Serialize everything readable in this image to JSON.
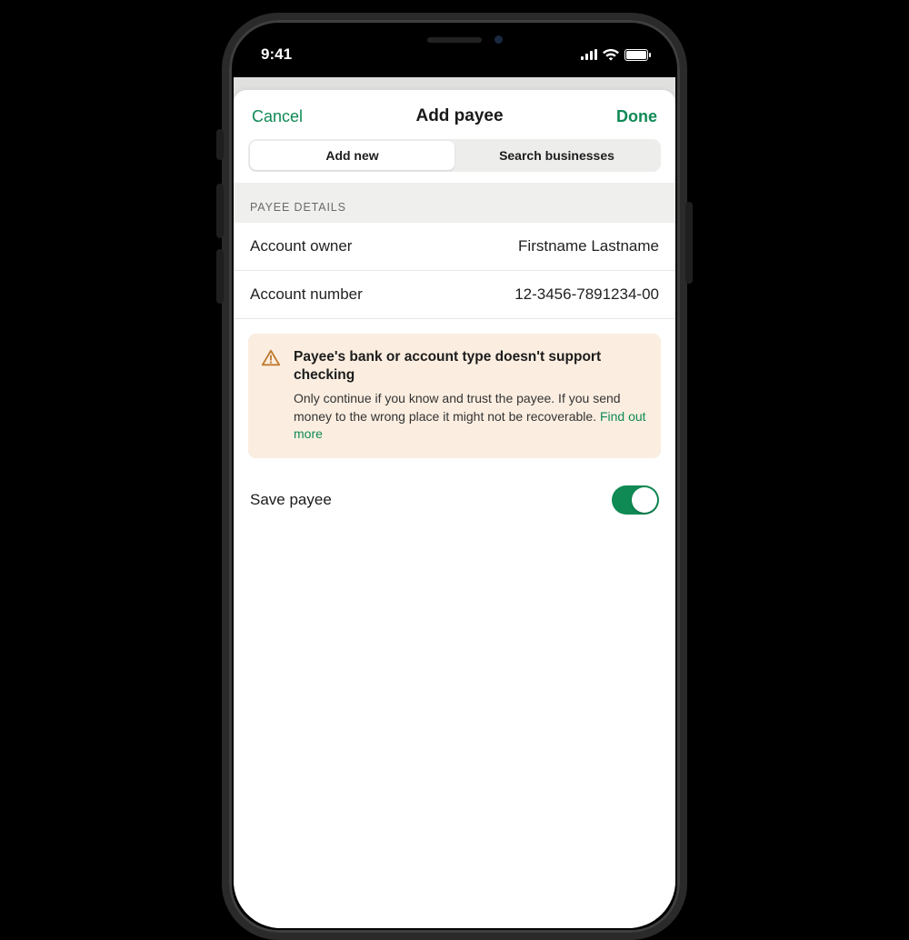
{
  "statusbar": {
    "time": "9:41"
  },
  "nav": {
    "cancel": "Cancel",
    "title": "Add payee",
    "done": "Done"
  },
  "segments": {
    "addnew": "Add new",
    "search": "Search businesses"
  },
  "section": {
    "header": "PAYEE DETAILS"
  },
  "details": {
    "owner_label": "Account owner",
    "owner_value": "Firstname Lastname",
    "number_label": "Account number",
    "number_value": "12-3456-7891234-00"
  },
  "warning": {
    "title": "Payee's bank or account type doesn't support checking",
    "body": "Only continue if you know and trust the payee. If you send money to the wrong place it might not be recoverable. ",
    "link": "Find out more"
  },
  "save": {
    "label": "Save payee",
    "on": true
  }
}
